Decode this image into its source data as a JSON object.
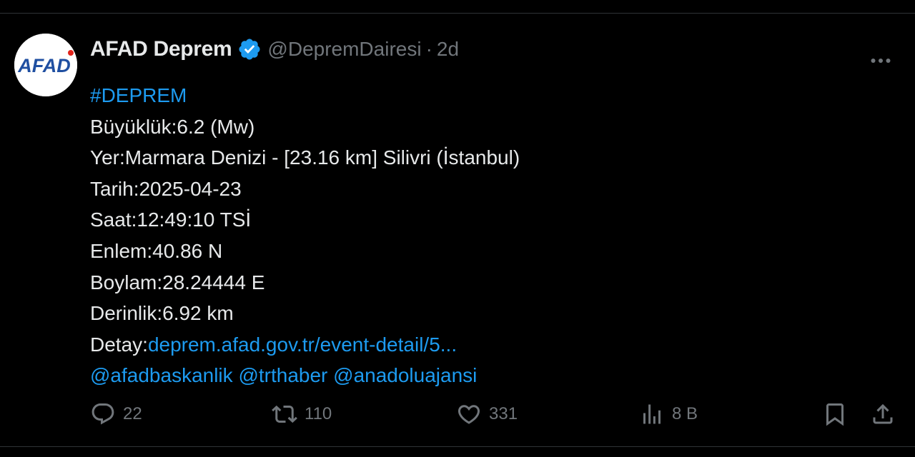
{
  "author": {
    "display_name": "AFAD Deprem",
    "handle": "@DepremDairesi",
    "separator": "·",
    "time": "2d",
    "avatar_text": "AFAD",
    "verified_color": "#1d9bf0"
  },
  "tweet": {
    "hashtag": "#DEPREM",
    "lines": [
      "Büyüklük:6.2 (Mw)",
      "Yer:Marmara Denizi - [23.16 km] Silivri (İstanbul)",
      "Tarih:2025-04-23",
      "Saat:12:49:10 TSİ",
      "Enlem:40.86 N",
      "Boylam:28.24444 E",
      "Derinlik:6.92 km"
    ],
    "detail_label": "Detay:",
    "detail_link": "deprem.afad.gov.tr/event-detail/5...",
    "mentions": [
      "@afadbaskanlik",
      "@trthaber",
      "@anadoluajansi"
    ]
  },
  "actions": {
    "replies": "22",
    "reposts": "110",
    "likes": "331",
    "views": "8 B"
  },
  "colors": {
    "link": "#1d9bf0",
    "muted": "#71767b",
    "text": "#e7e9ea",
    "background": "#000000",
    "logo_blue": "#1f4fa1",
    "logo_red": "#e2231a"
  }
}
